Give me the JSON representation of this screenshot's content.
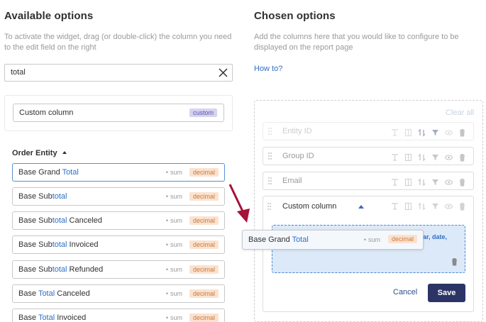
{
  "available": {
    "title": "Available options",
    "description": "To activate the widget, drag (or double-click) the column you need to the edit field on the right",
    "search_value": "total",
    "custom_label": "Custom column",
    "custom_badge": "custom",
    "group_title": "Order Entity",
    "items": [
      {
        "pre": "Base Grand ",
        "hl": "Total",
        "post": "",
        "agg": "sum",
        "type": "decimal"
      },
      {
        "pre": "Base Sub",
        "hl": "total",
        "post": "",
        "agg": "sum",
        "type": "decimal"
      },
      {
        "pre": "Base Sub",
        "hl": "total",
        "post": " Canceled",
        "agg": "sum",
        "type": "decimal"
      },
      {
        "pre": "Base Sub",
        "hl": "total",
        "post": " Invoiced",
        "agg": "sum",
        "type": "decimal"
      },
      {
        "pre": "Base Sub",
        "hl": "total",
        "post": " Refunded",
        "agg": "sum",
        "type": "decimal"
      },
      {
        "pre": "Base ",
        "hl": "Total",
        "post": " Canceled",
        "agg": "sum",
        "type": "decimal"
      },
      {
        "pre": "Base ",
        "hl": "Total",
        "post": " Invoiced",
        "agg": "sum",
        "type": "decimal"
      }
    ]
  },
  "chosen": {
    "title": "Chosen options",
    "description": "Add the columns here that you would like to configure to be displayed on the report page",
    "how_to": "How to?",
    "clear_all": "Clear all",
    "rows": [
      "Entity ID",
      "Group ID",
      "Email"
    ],
    "expanded_label": "Custom column",
    "drop_hint": "ar, date,",
    "cancel": "Cancel",
    "save": "Save"
  },
  "drag_ghost": {
    "pre": "Base Grand ",
    "hl": "Total",
    "agg": "sum",
    "type": "decimal"
  },
  "colors": {
    "accent": "#2f6fc5",
    "save_bg": "#2c3466",
    "decimal_bg": "#fbe2cf",
    "custom_bg": "#d5d3f0",
    "arrow": "#a5123a"
  }
}
